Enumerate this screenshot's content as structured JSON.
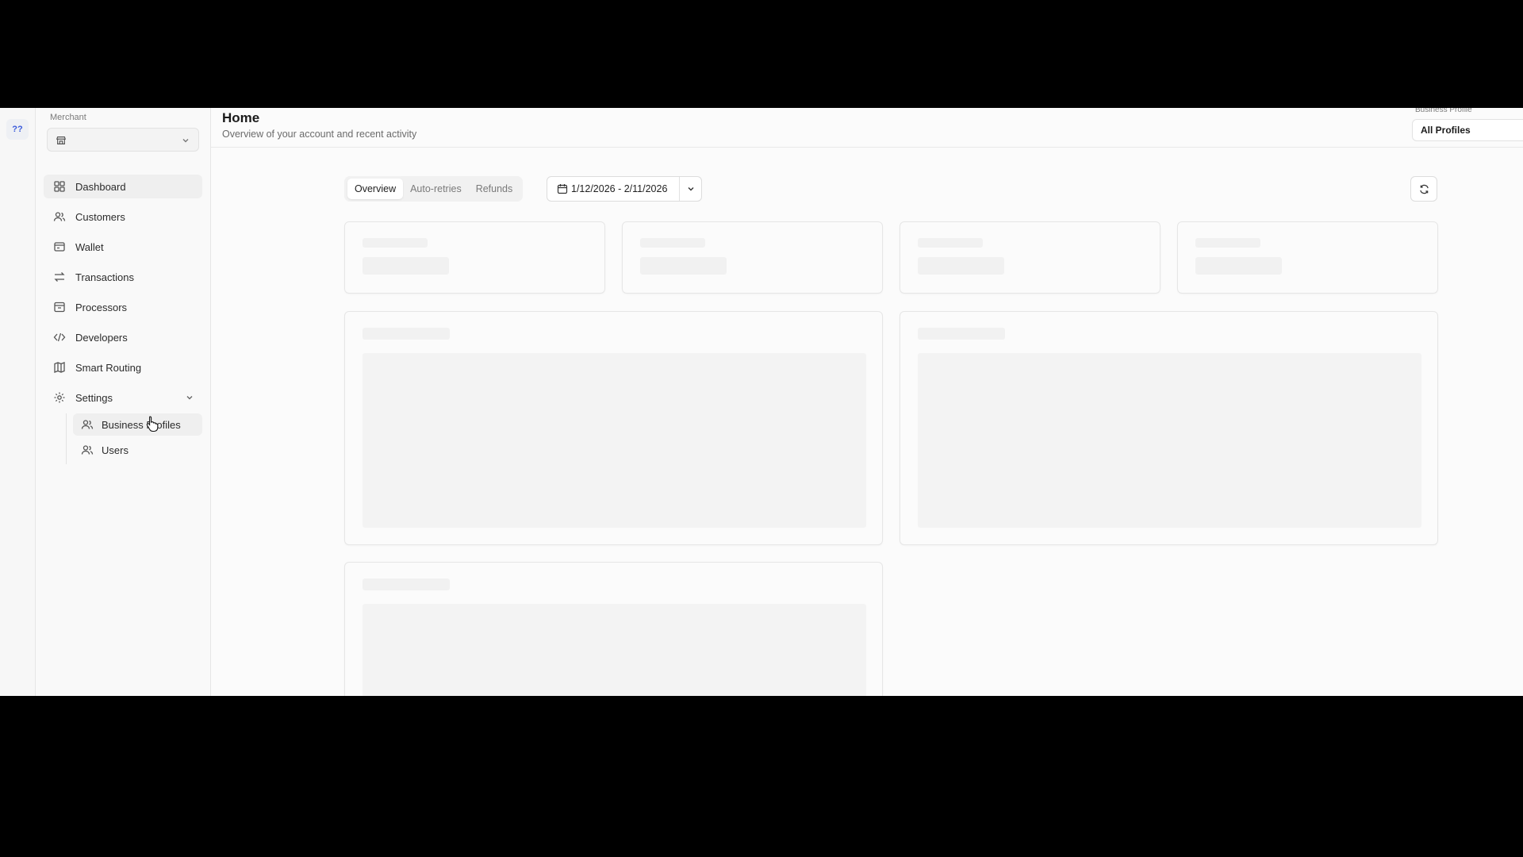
{
  "rail": {
    "badge": "??"
  },
  "sidebar": {
    "merchant_label": "Merchant",
    "merchant_value": "",
    "items": [
      {
        "label": "Dashboard",
        "icon": "grid-icon"
      },
      {
        "label": "Customers",
        "icon": "users-icon"
      },
      {
        "label": "Wallet",
        "icon": "wallet-icon"
      },
      {
        "label": "Transactions",
        "icon": "arrows-swap-icon"
      },
      {
        "label": "Processors",
        "icon": "store-icon"
      },
      {
        "label": "Developers",
        "icon": "code-icon"
      },
      {
        "label": "Smart Routing",
        "icon": "map-icon"
      },
      {
        "label": "Settings",
        "icon": "gear-icon"
      }
    ],
    "settings_children": [
      {
        "label": "Business Profiles",
        "icon": "users-icon"
      },
      {
        "label": "Users",
        "icon": "users-icon"
      }
    ]
  },
  "header": {
    "title": "Home",
    "subtitle": "Overview of your account and recent activity",
    "business_profile_label": "Business Profile",
    "business_profile_value": "All Profiles"
  },
  "toolbar": {
    "tabs": [
      "Overview",
      "Auto-retries",
      "Refunds"
    ],
    "active_tab": "Overview",
    "date_range": "1/12/2026 - 2/11/2026"
  },
  "colors": {
    "background": "#fbfbfb",
    "sidebar": "#f9f9f9",
    "skeleton": "#f1f1f1",
    "border": "#e6e6e6"
  }
}
